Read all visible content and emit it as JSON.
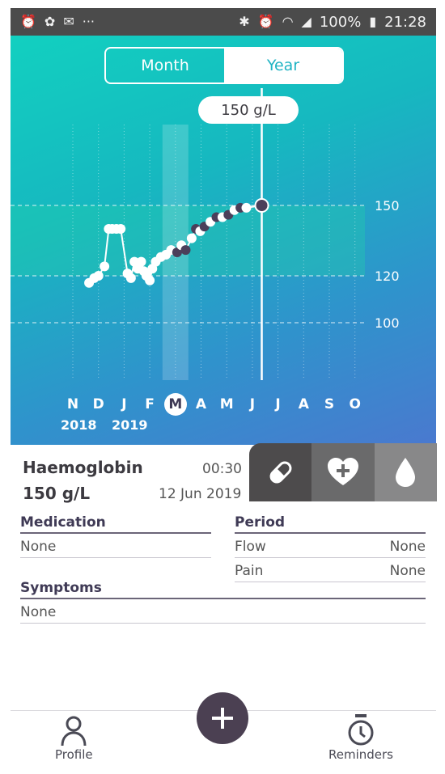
{
  "status_bar": {
    "left_icons": [
      "alarm-icon",
      "fan-icon",
      "mail-icon",
      "more-icon"
    ],
    "more_glyph": "···",
    "right_icons": [
      "bluetooth-icon",
      "alarm-icon",
      "wifi-icon",
      "signal-icon",
      "battery-icon"
    ],
    "battery": "100%",
    "time": "21:28"
  },
  "toggle": {
    "month_label": "Month",
    "year_label": "Year",
    "selected": "Month"
  },
  "tooltip": {
    "text": "150 g/L"
  },
  "chart_data": {
    "type": "line",
    "title": "",
    "xlabel": "",
    "ylabel": "",
    "ytick_labels": [
      "150",
      "120",
      "100"
    ],
    "normal_range": [
      120,
      150
    ],
    "months": [
      "N",
      "D",
      "J",
      "F",
      "M",
      "A",
      "M",
      "J",
      "J",
      "A",
      "S",
      "O"
    ],
    "selected_month_index": 4,
    "years": [
      "2018",
      "2019"
    ],
    "series": [
      {
        "points": [
          {
            "x": "2018-11-20",
            "y": 117
          },
          {
            "x": "2018-11-26",
            "y": 119
          },
          {
            "x": "2018-12-01",
            "y": 120
          },
          {
            "x": "2018-12-08",
            "y": 124
          },
          {
            "x": "2018-12-13",
            "y": 140
          },
          {
            "x": "2018-12-17",
            "y": 140
          },
          {
            "x": "2018-12-22",
            "y": 140
          },
          {
            "x": "2018-12-27",
            "y": 140
          },
          {
            "x": "2019-01-05",
            "y": 121
          },
          {
            "x": "2019-01-09",
            "y": 119
          },
          {
            "x": "2019-01-13",
            "y": 126
          },
          {
            "x": "2019-01-17",
            "y": 123
          },
          {
            "x": "2019-01-21",
            "y": 126
          },
          {
            "x": "2019-01-24",
            "y": 122
          },
          {
            "x": "2019-01-27",
            "y": 120
          },
          {
            "x": "2019-01-31",
            "y": 118
          },
          {
            "x": "2019-02-04",
            "y": 123
          },
          {
            "x": "2019-02-08",
            "y": 126
          },
          {
            "x": "2019-02-14",
            "y": 128
          },
          {
            "x": "2019-02-20",
            "y": 129
          },
          {
            "x": "2019-02-26",
            "y": 131
          },
          {
            "x": "2019-03-03",
            "y": 130
          },
          {
            "x": "2019-03-08",
            "y": 133
          },
          {
            "x": "2019-03-13",
            "y": 131
          },
          {
            "x": "2019-03-20",
            "y": 136
          },
          {
            "x": "2019-03-25",
            "y": 140
          },
          {
            "x": "2019-03-30",
            "y": 139
          },
          {
            "x": "2019-04-05",
            "y": 141
          },
          {
            "x": "2019-04-12",
            "y": 143
          },
          {
            "x": "2019-04-19",
            "y": 145
          },
          {
            "x": "2019-04-26",
            "y": 145
          },
          {
            "x": "2019-05-03",
            "y": 146
          },
          {
            "x": "2019-05-10",
            "y": 148
          },
          {
            "x": "2019-05-17",
            "y": 149
          },
          {
            "x": "2019-05-24",
            "y": 149
          },
          {
            "x": "2019-06-12",
            "y": 150
          }
        ]
      }
    ],
    "grid": true,
    "colors": {
      "white_points": "#ffffff",
      "dark_points": "#4b3f5a",
      "normal_band": "#22d0a8"
    }
  },
  "reading": {
    "name": "Haemoglobin",
    "value": "150 g/L",
    "time": "00:30",
    "date": "12 Jun 2019"
  },
  "tabs": [
    {
      "icon": "pill-icon"
    },
    {
      "icon": "heart-plus-icon"
    },
    {
      "icon": "drop-icon"
    }
  ],
  "medication": {
    "title": "Medication",
    "value": "None"
  },
  "period": {
    "title": "Period",
    "rows": [
      {
        "label": "Flow",
        "value": "None"
      },
      {
        "label": "Pain",
        "value": "None"
      }
    ]
  },
  "symptoms": {
    "title": "Symptoms",
    "value": "None"
  },
  "bottom_nav": {
    "profile_label": "Profile",
    "reminders_label": "Reminders",
    "add_icon": "plus-icon"
  },
  "colors": {
    "gradient_top": "#12d0c0",
    "gradient_bottom": "#4a79cf",
    "accent_dark": "#4b4052"
  }
}
